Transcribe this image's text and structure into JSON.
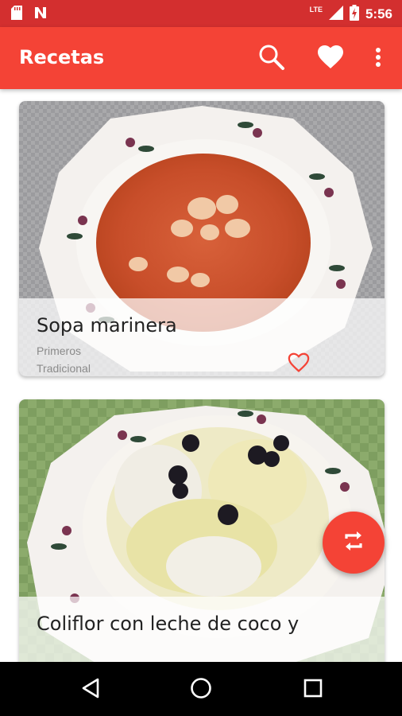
{
  "status_bar": {
    "time": "5:56",
    "network": "LTE",
    "icons": [
      "sd-card-icon",
      "n-notification-icon",
      "signal-icon",
      "battery-charging-icon"
    ]
  },
  "app_bar": {
    "title": "Recetas",
    "actions": [
      "search-icon",
      "favorite-icon",
      "more-vert-icon"
    ]
  },
  "recipes": [
    {
      "title": "Sopa marinera",
      "category": "Primeros",
      "style": "Tradicional",
      "favorite": false
    },
    {
      "title": "Coliflor con leche de coco y",
      "category": "",
      "style": "",
      "favorite": false
    }
  ],
  "fab": {
    "icon": "swap-icon"
  },
  "nav_bar": {
    "icons": [
      "back-icon",
      "home-icon",
      "recents-icon"
    ]
  },
  "colors": {
    "primary": "#f44336",
    "primary_dark": "#d32f2f",
    "card_overlay": "#ffffff",
    "title_text": "#222222",
    "secondary_text": "#8a8a8a"
  }
}
